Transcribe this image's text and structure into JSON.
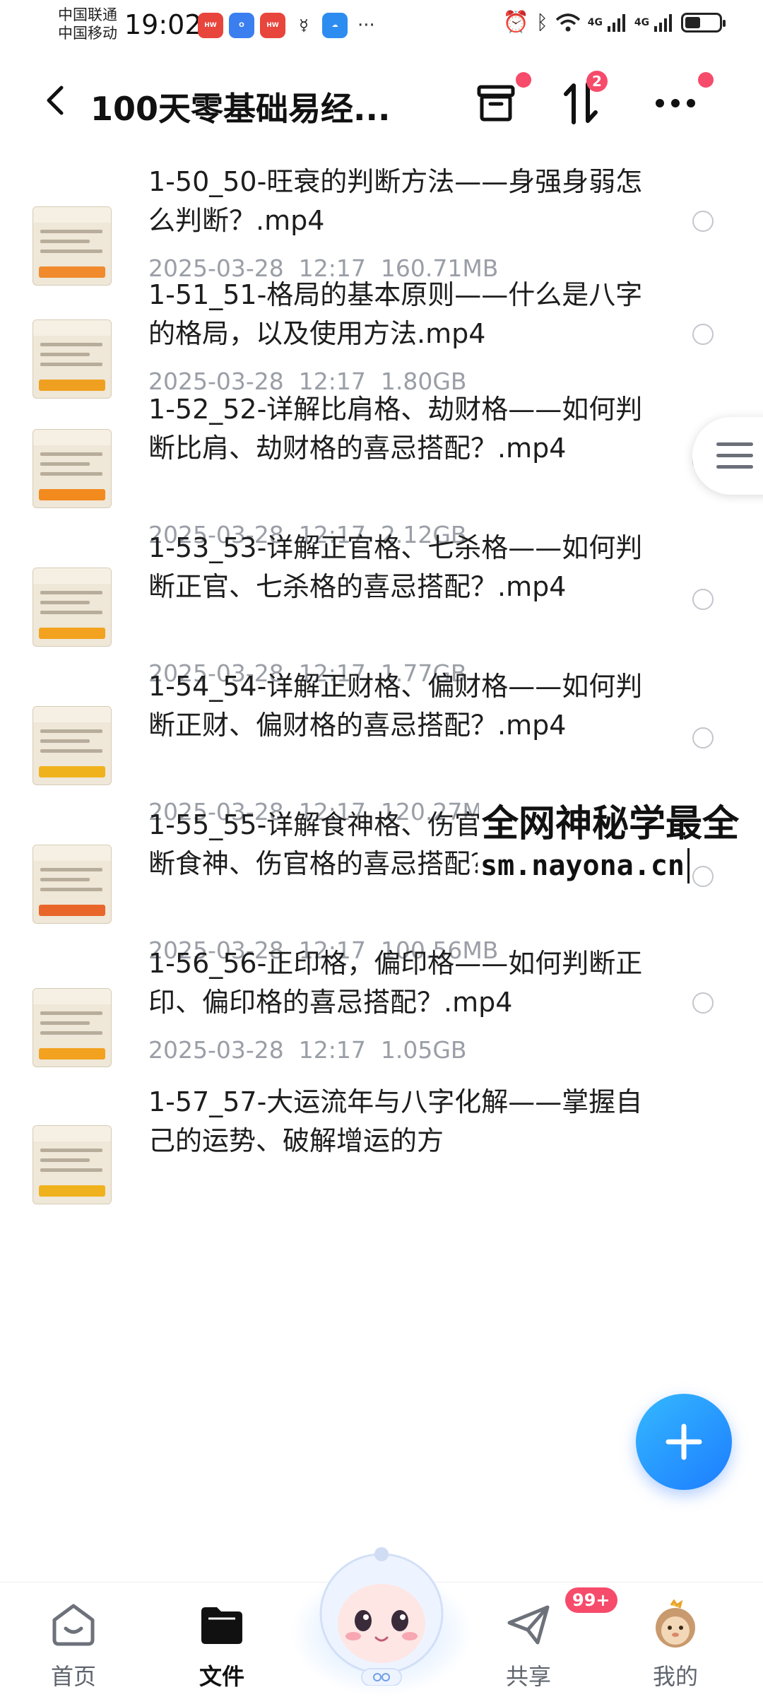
{
  "status_bar": {
    "carrier_1": "中国联通",
    "carrier_2": "中国移动",
    "time": "19:02",
    "more": "···",
    "signal_1": "4G",
    "signal_2": "4G",
    "battery_level": 0.45
  },
  "header": {
    "title": "100天零基础易经...",
    "transfer_badge": "2"
  },
  "files": [
    {
      "name": "1-50_50-旺衰的判断方法——身强身弱怎么判断？.mp4",
      "date": "2025-03-28",
      "time": "12:17",
      "size": "160.71MB",
      "thumb_color": "#f08a2c"
    },
    {
      "name": "1-51_51-格局的基本原则——什么是八字的格局，以及使用方法.mp4",
      "date": "2025-03-28",
      "time": "12:17",
      "size": "1.80GB",
      "thumb_color": "#f0a020"
    },
    {
      "name": "1-52_52-详解比肩格、劫财格——如何判断比肩、劫财格的喜忌搭配？.mp4",
      "date": "2025-03-28",
      "time": "12:17",
      "size": "2.12GB",
      "thumb_color": "#f28a1e"
    },
    {
      "name": "1-53_53-详解正官格、七杀格——如何判断正官、七杀格的喜忌搭配？.mp4",
      "date": "2025-03-28",
      "time": "12:17",
      "size": "1.77GB",
      "thumb_color": "#f2a21e"
    },
    {
      "name": "1-54_54-详解正财格、偏财格——如何判断正财、偏财格的喜忌搭配？.mp4",
      "date": "2025-03-28",
      "time": "12:17",
      "size": "120.27MB",
      "thumb_color": "#f0b21c"
    },
    {
      "name": "1-55_55-详解食神格、伤官格——如何判断食神、伤官格的喜忌搭配？.mp4",
      "date": "2025-03-28",
      "time": "12:17",
      "size": "100.56MB",
      "thumb_color": "#e8662a"
    },
    {
      "name": "1-56_56-正印格，偏印格——如何判断正印、偏印格的喜忌搭配？.mp4",
      "date": "2025-03-28",
      "time": "12:17",
      "size": "1.05GB",
      "thumb_color": "#f2a21e"
    },
    {
      "name": "1-57_57-大运流年与八字化解——掌握自己的运势、破解增运的方",
      "date": "",
      "time": "",
      "size": "",
      "thumb_color": "#f0b21c"
    }
  ],
  "watermark": {
    "title": "全网神秘学最全",
    "url": "sm.nayona.cn"
  },
  "tab_bar": {
    "tabs": [
      {
        "label": "首页",
        "active": false
      },
      {
        "label": "文件",
        "active": true
      },
      {
        "label": "共享",
        "active": false
      },
      {
        "label": "我的",
        "active": false
      }
    ],
    "share_badge": "99+"
  },
  "colors": {
    "accent": "#1d7dff",
    "badge": "#f64b6a",
    "meta_text": "#9a9ea6"
  }
}
